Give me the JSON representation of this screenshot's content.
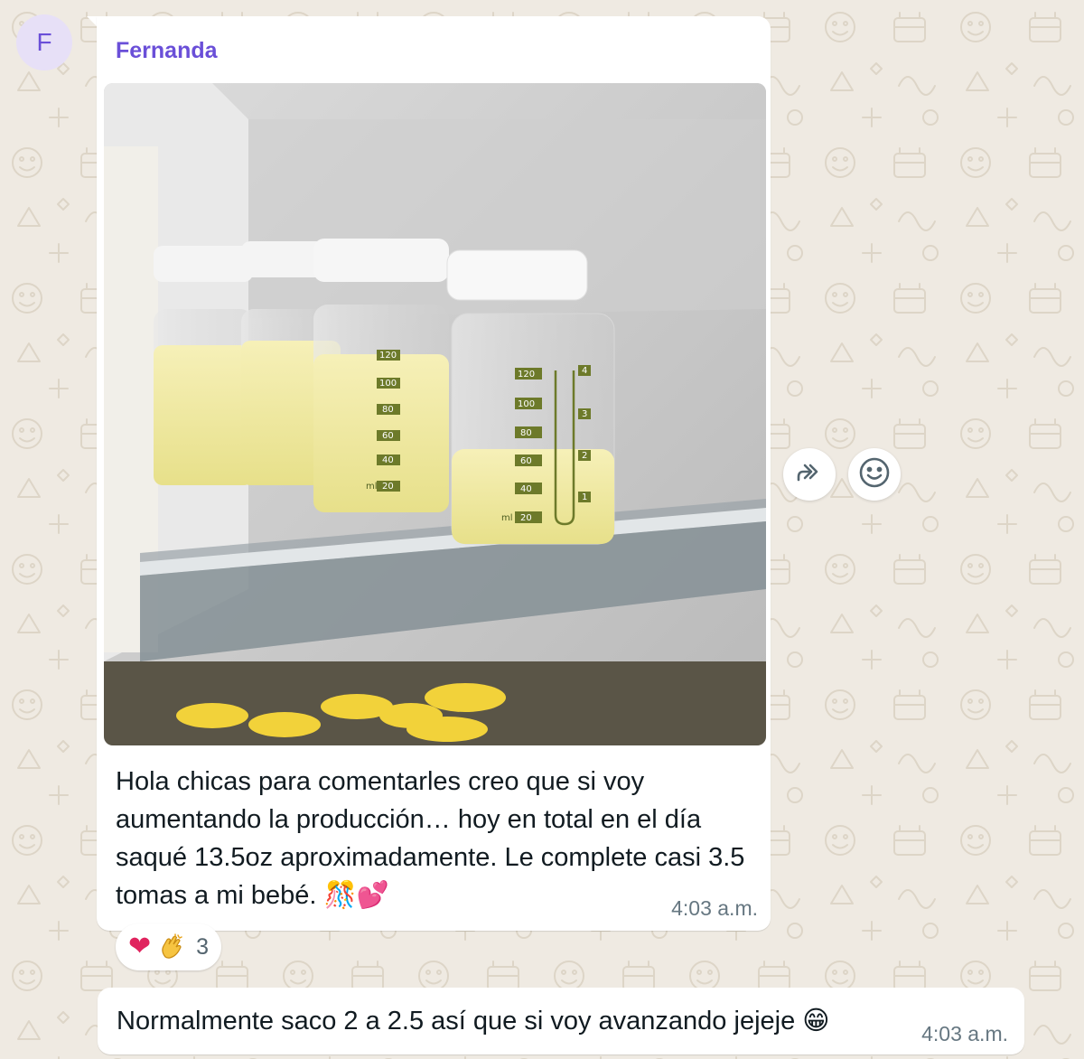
{
  "chat": {
    "avatar_letter": "F",
    "sender_name": "Fernanda",
    "messages": [
      {
        "caption": "Hola chicas para comentarles creo que si voy aumentando la producción… hoy en total en el día saqué 13.5oz aproximadamente. Le complete casi 3.5 tomas a mi bebé. 🎊💕",
        "time": "4:03 a.m.",
        "photo": {
          "bottle_marks": [
            "120",
            "100",
            "80",
            "60",
            "40",
            "20"
          ],
          "oz_marks": [
            "4",
            "3",
            "2",
            "1"
          ],
          "unit_label": "ml"
        }
      },
      {
        "text": "Normalmente saco 2 a 2.5 así que si voy avanzando jejeje 😁",
        "time": "4:03 a.m."
      }
    ],
    "reactions": {
      "icons": [
        "heart-icon",
        "clapping-hands-icon"
      ],
      "count": "3"
    },
    "actions": {
      "forward_icon": "forward-icon",
      "react_icon": "smiley-icon"
    }
  }
}
